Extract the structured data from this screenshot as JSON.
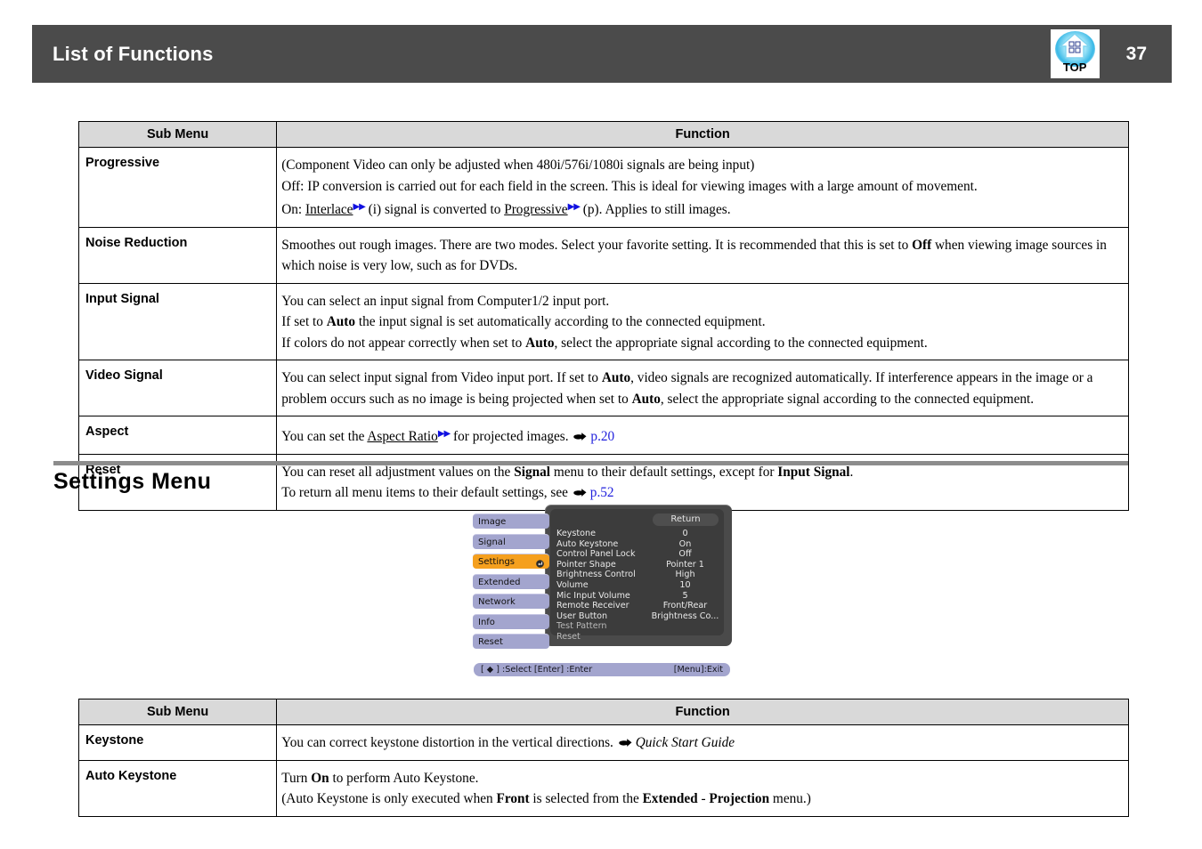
{
  "header": {
    "title": "List of Functions",
    "page_number": "37",
    "badge_label": "TOP",
    "badge_icon": "home-top-icon",
    "bar_color": "#4b4b4b"
  },
  "signal_table": {
    "headers": {
      "sub_menu": "Sub Menu",
      "function": "Function"
    },
    "rows": [
      {
        "sub_menu": "Progressive",
        "lines": [
          {
            "segments": [
              {
                "t": "(Component Video can only be adjusted when 480i/576i/1080i signals are being input)"
              }
            ]
          },
          {
            "segments": [
              {
                "t": "Off: IP conversion is carried out for each field in the screen. This is ideal for viewing images with a large amount of movement."
              }
            ]
          },
          {
            "segments": [
              {
                "t": "On: "
              },
              {
                "t": "Interlace",
                "style": "glossary"
              },
              {
                "t": " (i) signal is converted to "
              },
              {
                "t": "Progressive",
                "style": "glossary"
              },
              {
                "t": " (p). Applies to still images."
              }
            ]
          }
        ]
      },
      {
        "sub_menu": "Noise Reduction",
        "lines": [
          {
            "segments": [
              {
                "t": "Smoothes out rough images. There are two modes. Select your favorite setting. It is recommended that this is set to "
              },
              {
                "t": "Off",
                "style": "bold"
              },
              {
                "t": " when viewing image sources in which noise is very low, such as for DVDs."
              }
            ]
          }
        ]
      },
      {
        "sub_menu": "Input Signal",
        "lines": [
          {
            "segments": [
              {
                "t": "You can select an input signal from Computer1/2 input port."
              }
            ]
          },
          {
            "segments": [
              {
                "t": "If set to "
              },
              {
                "t": "Auto",
                "style": "bold"
              },
              {
                "t": " the input signal is set automatically according to the connected equipment."
              }
            ]
          },
          {
            "segments": [
              {
                "t": "If colors do not appear correctly when set to "
              },
              {
                "t": "Auto",
                "style": "bold"
              },
              {
                "t": ", select the appropriate signal according to the connected equipment."
              }
            ]
          }
        ]
      },
      {
        "sub_menu": "Video Signal",
        "lines": [
          {
            "segments": [
              {
                "t": "You can select input signal from Video input port. If set to "
              },
              {
                "t": "Auto",
                "style": "bold"
              },
              {
                "t": ", video signals are recognized automatically. If interference appears in the image or a problem occurs such as no image is being projected when set to "
              },
              {
                "t": "Auto",
                "style": "bold"
              },
              {
                "t": ", select the appropriate signal according to the connected equipment."
              }
            ]
          }
        ]
      },
      {
        "sub_menu": "Aspect",
        "lines": [
          {
            "segments": [
              {
                "t": "You can set the "
              },
              {
                "t": "Aspect Ratio",
                "style": "glossary"
              },
              {
                "t": " for projected images. "
              },
              {
                "t": "",
                "style": "hand"
              },
              {
                "t": "p.20",
                "style": "pageref"
              }
            ]
          }
        ]
      },
      {
        "sub_menu": "Reset",
        "lines": [
          {
            "segments": [
              {
                "t": "You can reset all adjustment values on the "
              },
              {
                "t": "Signal",
                "style": "bold"
              },
              {
                "t": " menu to their default settings, except for "
              },
              {
                "t": "Input Signal",
                "style": "bold"
              },
              {
                "t": "."
              }
            ]
          },
          {
            "segments": [
              {
                "t": "To return all menu items to their default settings, see "
              },
              {
                "t": "",
                "style": "hand"
              },
              {
                "t": "p.52",
                "style": "pageref"
              }
            ]
          }
        ]
      }
    ]
  },
  "section": {
    "title": "Settings Menu"
  },
  "osd": {
    "sidebar": [
      {
        "label": "Image",
        "active": false
      },
      {
        "label": "Signal",
        "active": false
      },
      {
        "label": "Settings",
        "active": true,
        "icon": "enter-arrow-icon"
      },
      {
        "label": "Extended",
        "active": false
      },
      {
        "label": "Network",
        "active": false
      },
      {
        "label": "Info",
        "active": false
      },
      {
        "label": "Reset",
        "active": false
      }
    ],
    "return_label": "Return",
    "items": [
      {
        "label": "Keystone",
        "value": "0",
        "dim": false
      },
      {
        "label": "Auto Keystone",
        "value": "On",
        "dim": false
      },
      {
        "label": "Control Panel Lock",
        "value": "Off",
        "dim": false
      },
      {
        "label": "Pointer Shape",
        "value": "Pointer 1",
        "dim": false
      },
      {
        "label": "Brightness Control",
        "value": "High",
        "dim": false
      },
      {
        "label": "Volume",
        "value": "10",
        "dim": false
      },
      {
        "label": "Mic Input Volume",
        "value": "5",
        "dim": false
      },
      {
        "label": "Remote Receiver",
        "value": "Front/Rear",
        "dim": false
      },
      {
        "label": "User Button",
        "value": "Brightness Co...",
        "dim": false
      },
      {
        "label": "Test Pattern",
        "value": "",
        "dim": true
      },
      {
        "label": "Reset",
        "value": "",
        "dim": true
      }
    ],
    "status_left": "[ ◆ ] :Select  [Enter] :Enter",
    "status_right": "[Menu]:Exit",
    "colors": {
      "active_tab": "#f5a01e",
      "tab": "#a3a5ce",
      "panel": "#3c3c3c"
    }
  },
  "settings_table": {
    "headers": {
      "sub_menu": "Sub Menu",
      "function": "Function"
    },
    "rows": [
      {
        "sub_menu": "Keystone",
        "lines": [
          {
            "segments": [
              {
                "t": "You can correct keystone distortion in the vertical directions. "
              },
              {
                "t": "",
                "style": "hand"
              },
              {
                "t": "Quick Start Guide",
                "style": "italic"
              }
            ]
          }
        ]
      },
      {
        "sub_menu": "Auto Keystone",
        "lines": [
          {
            "segments": [
              {
                "t": "Turn "
              },
              {
                "t": "On",
                "style": "bold"
              },
              {
                "t": " to perform Auto Keystone."
              }
            ]
          },
          {
            "segments": [
              {
                "t": "(Auto Keystone is only executed when "
              },
              {
                "t": "Front",
                "style": "bold"
              },
              {
                "t": " is selected from the "
              },
              {
                "t": "Extended",
                "style": "bold"
              },
              {
                "t": " - "
              },
              {
                "t": "Projection",
                "style": "bold"
              },
              {
                "t": " menu.)"
              }
            ]
          }
        ]
      }
    ]
  }
}
